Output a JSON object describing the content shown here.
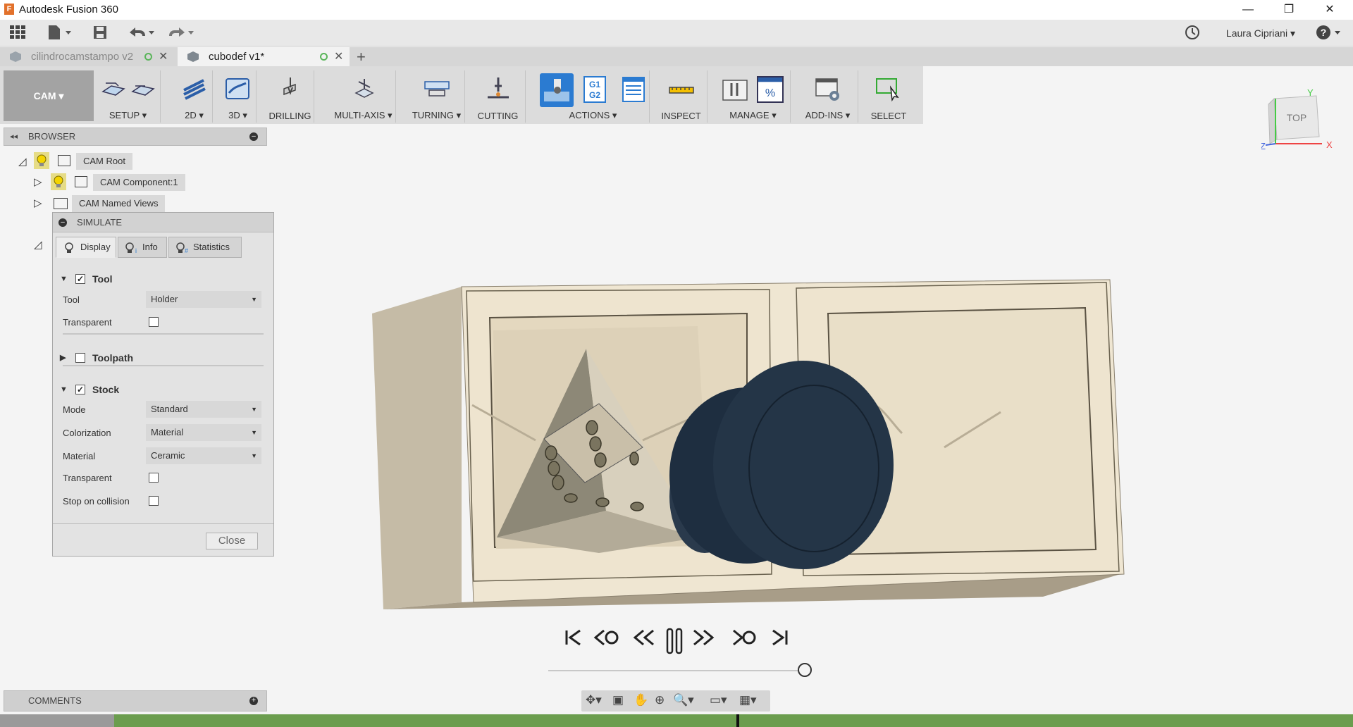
{
  "window": {
    "title": "Autodesk Fusion 360",
    "app_icon": "F"
  },
  "quick_access": {
    "user": "Laura Cipriani ▾"
  },
  "doc_tabs": [
    {
      "label": "cilindrocamstampo v2"
    },
    {
      "label": "cubodef v1*"
    }
  ],
  "ribbon": {
    "workspace": "CAM ▾",
    "groups": [
      {
        "label": "SETUP ▾"
      },
      {
        "label": "2D ▾"
      },
      {
        "label": "3D ▾"
      },
      {
        "label": "DRILLING"
      },
      {
        "label": "MULTI-AXIS ▾"
      },
      {
        "label": "TURNING ▾"
      },
      {
        "label": "CUTTING"
      },
      {
        "label": "ACTIONS ▾"
      },
      {
        "label": "INSPECT"
      },
      {
        "label": "MANAGE ▾"
      },
      {
        "label": "ADD-INS ▾"
      },
      {
        "label": "SELECT"
      }
    ],
    "g1g2_text": "G1\nG2"
  },
  "browser": {
    "title": "BROWSER",
    "items": [
      {
        "label": "CAM Root"
      },
      {
        "label": "CAM Component:1"
      },
      {
        "label": "CAM Named Views"
      }
    ]
  },
  "simulate": {
    "title": "SIMULATE",
    "tabs": [
      {
        "label": "Display"
      },
      {
        "label": "Info"
      },
      {
        "label": "Statistics"
      }
    ],
    "tool_section": {
      "label": "Tool",
      "checked": true
    },
    "tool_label": "Tool",
    "tool_value": "Holder",
    "tool_transparent_label": "Transparent",
    "toolpath_section": {
      "label": "Toolpath",
      "checked": false
    },
    "stock_section": {
      "label": "Stock",
      "checked": true
    },
    "mode_label": "Mode",
    "mode_value": "Standard",
    "colorization_label": "Colorization",
    "colorization_value": "Material",
    "material_label": "Material",
    "material_value": "Ceramic",
    "stock_transparent_label": "Transparent",
    "stop_collision_label": "Stop on collision",
    "close_label": "Close"
  },
  "comments": {
    "title": "COMMENTS"
  },
  "viewcube": {
    "face": "TOP",
    "axis_x": "X",
    "axis_y": "Y",
    "axis_z": "Z"
  },
  "playback": {
    "state": "playing"
  },
  "colors": {
    "accent": "#2b7bd1",
    "progress": "#6b9d4e",
    "stock": "#efe6d2",
    "tool": "#1e2e40"
  }
}
